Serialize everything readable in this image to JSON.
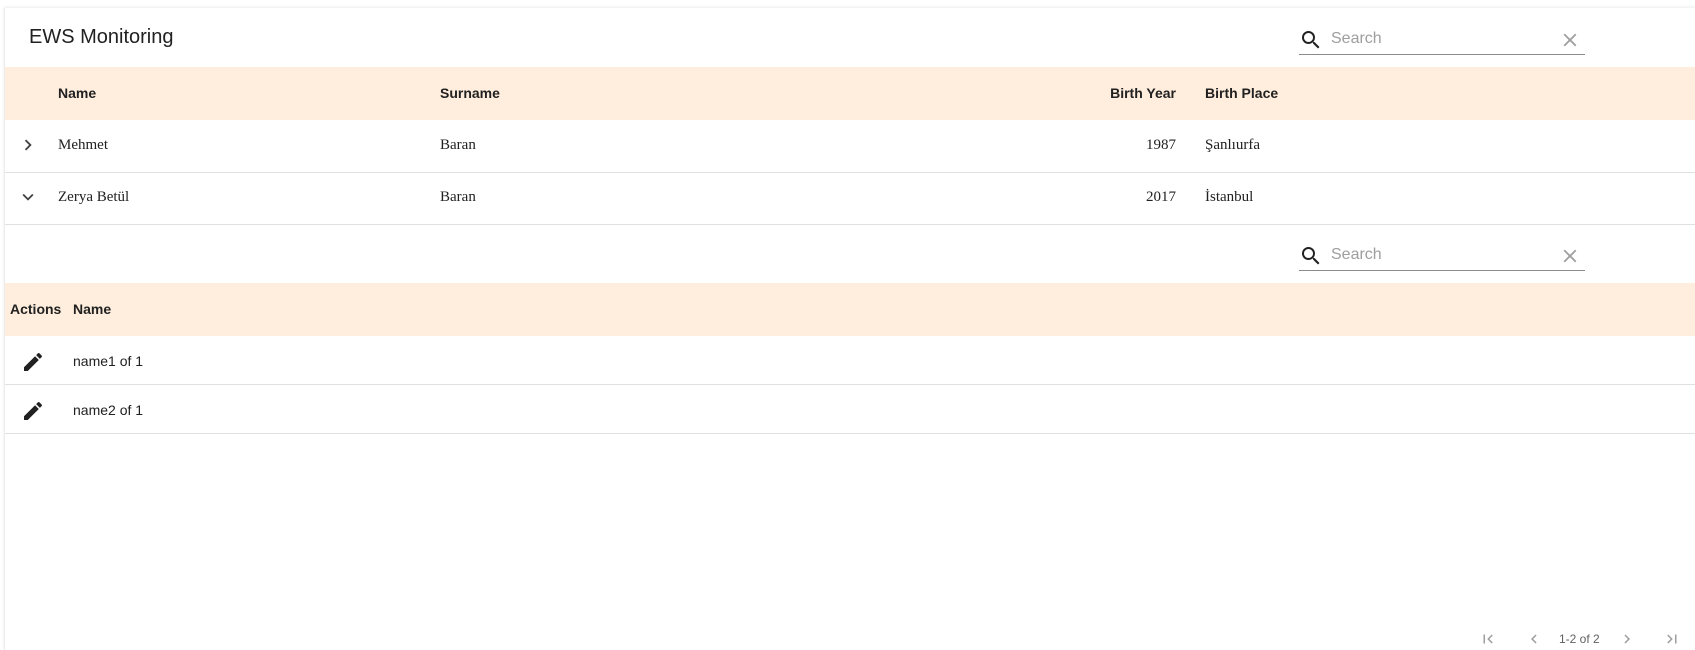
{
  "toolbar": {
    "title": "EWS Monitoring",
    "search_placeholder": "Search",
    "search_value": ""
  },
  "main_table": {
    "columns": [
      "Name",
      "Surname",
      "Birth Year",
      "Birth Place"
    ],
    "rows": [
      {
        "expander": "chevron-right-icon",
        "name": "Mehmet",
        "surname": "Baran",
        "birth_year": "1987",
        "birth_place": "Şanlıurfa"
      },
      {
        "expander": "chevron-down-icon",
        "name": "Zerya Betül",
        "surname": "Baran",
        "birth_year": "2017",
        "birth_place": "İstanbul"
      }
    ]
  },
  "detail_panel": {
    "search_placeholder": "Search",
    "search_value": "",
    "columns": [
      "Actions",
      "Name"
    ],
    "rows": [
      {
        "action_icon": "edit-icon",
        "name": "name1 of 1"
      },
      {
        "action_icon": "edit-icon",
        "name": "name2 of 1"
      }
    ]
  },
  "pagination": {
    "range_text": "1-2 of 2"
  },
  "colors": {
    "header_bg": "#ffeedd",
    "row_border": "#e0e0e0",
    "text": "#212121"
  }
}
